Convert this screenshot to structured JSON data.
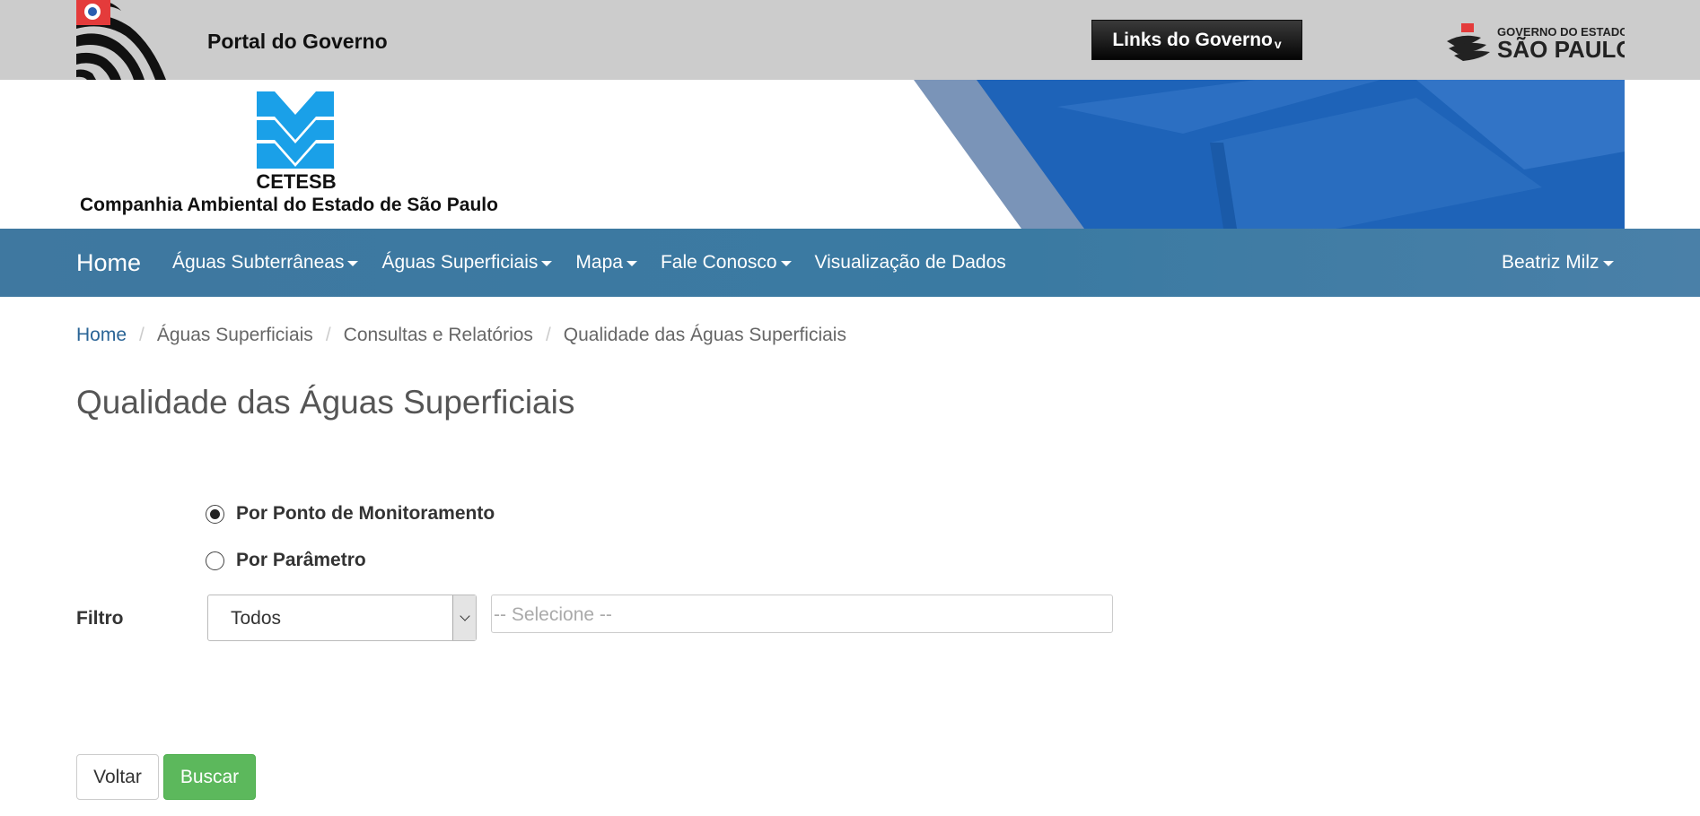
{
  "gov": {
    "portal_label": "Portal do Governo",
    "links_label": "Links do Governo",
    "links_caret": "v",
    "sp_logo_line1": "GOVERNO DO ESTADO",
    "sp_logo_line2": "SÃO PAULO"
  },
  "banner": {
    "logo_name": "CETESB",
    "full_name": "Companhia Ambiental do Estado de São Paulo"
  },
  "navbar": {
    "home": "Home",
    "items": [
      {
        "label": "Águas Subterrâneas"
      },
      {
        "label": "Águas Superficiais"
      },
      {
        "label": "Mapa"
      },
      {
        "label": "Fale Conosco"
      },
      {
        "label": "Visualização de Dados"
      }
    ],
    "user": "Beatriz Milz"
  },
  "breadcrumb": {
    "items": [
      "Home",
      "Águas Superficiais",
      "Consultas e Relatórios",
      "Qualidade das Águas Superficiais"
    ],
    "separator": "/"
  },
  "page": {
    "title": "Qualidade das Águas Superficiais"
  },
  "form": {
    "radio_options": [
      {
        "label": "Por Ponto de Monitoramento",
        "checked": true
      },
      {
        "label": "Por Parâmetro",
        "checked": false
      }
    ],
    "filtro_label": "Filtro",
    "filtro_value": "Todos",
    "select_placeholder": "-- Selecione --"
  },
  "buttons": {
    "voltar": "Voltar",
    "buscar": "Buscar"
  },
  "colors": {
    "gov_bar": "#cccccc",
    "navbar": "#3f78a0",
    "link": "#2a6496",
    "success": "#5cb85c"
  }
}
